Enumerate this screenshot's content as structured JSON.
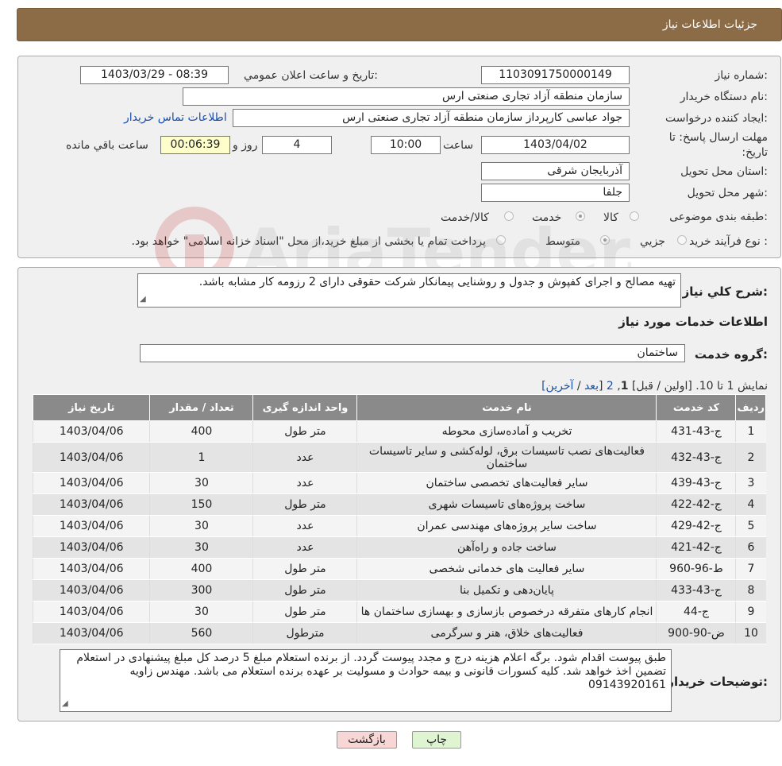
{
  "header": {
    "title": "جزئیات اطلاعات نیاز"
  },
  "info": {
    "need_number_label": "شماره نیاز:",
    "need_number": "1103091750000149",
    "announce_label": "تاریخ و ساعت اعلان عمومي:",
    "announce_value": "1403/03/29 - 08:39",
    "buyer_org_label": "نام دستگاه خریدار:",
    "buyer_org": "سازمان منطقه آزاد تجاری صنعتی ارس",
    "creator_label": "ایجاد کننده درخواست:",
    "creator": "جواد عباسی کارپرداز سازمان منطقه آزاد تجاری صنعتی ارس",
    "contact_link": "اطلاعات تماس خریدار",
    "deadline_label": "مهلت ارسال پاسخ: تا تاریخ:",
    "deadline_date": "1403/04/02",
    "time_label": "ساعت",
    "deadline_time": "10:00",
    "days_value": "4",
    "days_label": "روز و",
    "remaining_time": "00:06:39",
    "remaining_label": "ساعت باقي مانده",
    "province_label": "استان محل تحویل:",
    "province": "آذربایجان شرقی",
    "city_label": "شهر محل تحویل:",
    "city": "جلفا",
    "category_label": "طبقه بندی موضوعی:",
    "category_options": [
      "کالا",
      "خدمت",
      "کالا/خدمت"
    ],
    "category_selected": "خدمت",
    "process_label": "نوع فرآیند خرید :",
    "process_options": [
      "جزيي",
      "متوسط"
    ],
    "process_selected": "متوسط",
    "payment_note": "پرداخت تمام یا بخشی از مبلغ خرید،از محل \"اسناد خزانه اسلامی\" خواهد بود."
  },
  "summary": {
    "label": "شرح کلي نياز:",
    "text": "تهیه مصالح و اجرای کفپوش و جدول و روشنایی پیمانکار شرکت حقوقی دارای 2 رزومه کار مشابه باشد."
  },
  "services": {
    "section_title": "اطلاعات خدمات مورد نیاز",
    "group_label": "گروه خدمت:",
    "group_value": "ساختمان",
    "pagination": {
      "prefix": "نمایش 1 تا 10.",
      "first": "[اولین",
      "prev": "قبل]",
      "page1": "1",
      "page2": "2",
      "next": "بعد",
      "last": "آخرین]"
    },
    "columns": [
      "ردیف",
      "کد خدمت",
      "نام خدمت",
      "واحد اندازه گیری",
      "تعداد / مقدار",
      "تاریخ نیاز"
    ],
    "rows": [
      {
        "n": "1",
        "code": "ج-43-431",
        "name": "تخریب و آماده‌سازی محوطه",
        "unit": "متر طول",
        "qty": "400",
        "date": "1403/04/06"
      },
      {
        "n": "2",
        "code": "ج-43-432",
        "name": "فعالیت‌های نصب تاسیسات برق، لوله‌کشی و سایر تاسیسات ساختمان",
        "unit": "عدد",
        "qty": "1",
        "date": "1403/04/06"
      },
      {
        "n": "3",
        "code": "ج-43-439",
        "name": "سایر فعالیت‌های تخصصی ساختمان",
        "unit": "عدد",
        "qty": "30",
        "date": "1403/04/06"
      },
      {
        "n": "4",
        "code": "ج-42-422",
        "name": "ساخت پروژه‌های تاسیسات شهری",
        "unit": "متر طول",
        "qty": "150",
        "date": "1403/04/06"
      },
      {
        "n": "5",
        "code": "ج-42-429",
        "name": "ساخت سایر پروژه‌های مهندسی عمران",
        "unit": "عدد",
        "qty": "30",
        "date": "1403/04/06"
      },
      {
        "n": "6",
        "code": "ج-42-421",
        "name": "ساخت جاده و راه‌آهن",
        "unit": "عدد",
        "qty": "30",
        "date": "1403/04/06"
      },
      {
        "n": "7",
        "code": "ط-96-960",
        "name": "سایر فعالیت های خدماتی شخصی",
        "unit": "متر طول",
        "qty": "400",
        "date": "1403/04/06"
      },
      {
        "n": "8",
        "code": "ج-43-433",
        "name": "پایان‌دهی و تکمیل بنا",
        "unit": "متر طول",
        "qty": "300",
        "date": "1403/04/06"
      },
      {
        "n": "9",
        "code": "ج-44",
        "name": "انجام کارهای متفرقه درخصوص بازسازی و بهسازی ساختمان ها",
        "unit": "متر طول",
        "qty": "30",
        "date": "1403/04/06"
      },
      {
        "n": "10",
        "code": "ض-90-900",
        "name": "فعالیت‌های خلاق، هنر و سرگرمی",
        "unit": "مترطول",
        "qty": "560",
        "date": "1403/04/06"
      }
    ]
  },
  "buyer_notes": {
    "label": "توضیحات خریدار:",
    "text": "طبق پیوست اقدام شود. برگه اعلام هزینه درج و مجدد پیوست گردد. از برنده استعلام مبلغ 5 درصد کل مبلغ پیشنهادی در استعلام تضمین اخذ خواهد شد. کلیه کسورات قانونی و بیمه حوادث و مسولیت بر عهده برنده استعلام می باشد. مهندس زاویه 09143920161"
  },
  "buttons": {
    "print": "چاپ",
    "back": "بازگشت"
  },
  "watermark": "AriaTender.net",
  "colors": {
    "header": "#8b6c46",
    "table_header": "#8a8a8a",
    "back_button": "#f9d6d6",
    "print_button": "#dff5d2"
  }
}
